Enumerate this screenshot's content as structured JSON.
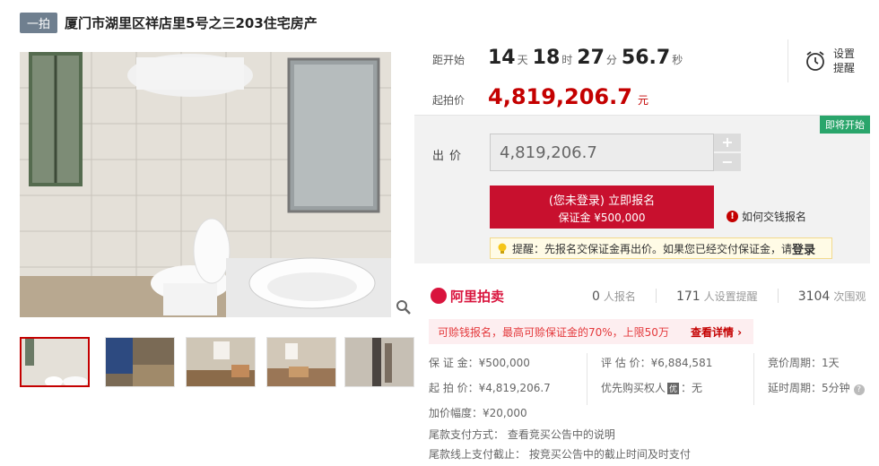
{
  "header": {
    "round_badge": "一拍",
    "title": "厦门市湖里区祥店里5号之三203住宅房产"
  },
  "countdown": {
    "label": "距开始",
    "days": "14",
    "days_unit": "天",
    "hours": "18",
    "hours_unit": "时",
    "minutes": "27",
    "minutes_unit": "分",
    "seconds": "56.7",
    "seconds_unit": "秒"
  },
  "reminder": {
    "line1": "设置",
    "line2": "提醒",
    "icon": "alarm-clock-icon"
  },
  "start_price": {
    "label": "起拍价",
    "value": "4,819,206.7",
    "unit": "元"
  },
  "bid": {
    "status_tag": "即将开始",
    "label": "出价",
    "input_value": "4,819,206.7",
    "plus": "+",
    "minus": "−",
    "signup_main": "(您未登录) 立即报名",
    "signup_sub": "保证金 ¥500,000",
    "howto_icon_text": "!",
    "howto": "如何交钱报名",
    "tip_text": "提醒：先报名交保证金再出价。如果您已经交付保证金，请",
    "tip_login": "登录"
  },
  "brand": {
    "name": "阿里拍卖"
  },
  "stats": {
    "signups_n": "0",
    "signups_l": "人报名",
    "reminders_n": "171",
    "reminders_l": "人设置提醒",
    "views_n": "3104",
    "views_l": "次围观"
  },
  "promo": {
    "text": "可赊钱报名，最高可赊保证金的70%，上限50万",
    "link": "查看详情 ›"
  },
  "info": {
    "deposit": "保 证 金：¥500,000",
    "appraisal": "评 估 价：¥6,884,581",
    "cycle": "竞价周期：1天",
    "start": "起 拍 价：¥4,819,206.7",
    "priority_pre": "优先购买权人",
    "priority_tag": "优",
    "priority_post": "：无",
    "delay": "延时周期：5分钟",
    "increment": "加价幅度：¥20,000",
    "payment": "尾款支付方式： 查看竞买公告中的说明",
    "deadline": "尾款线上支付截止： 按竞买公告中的截止时间及时支付"
  },
  "colors": {
    "accent": "#c40000",
    "button": "#c8102e",
    "status": "#2aa56b"
  }
}
